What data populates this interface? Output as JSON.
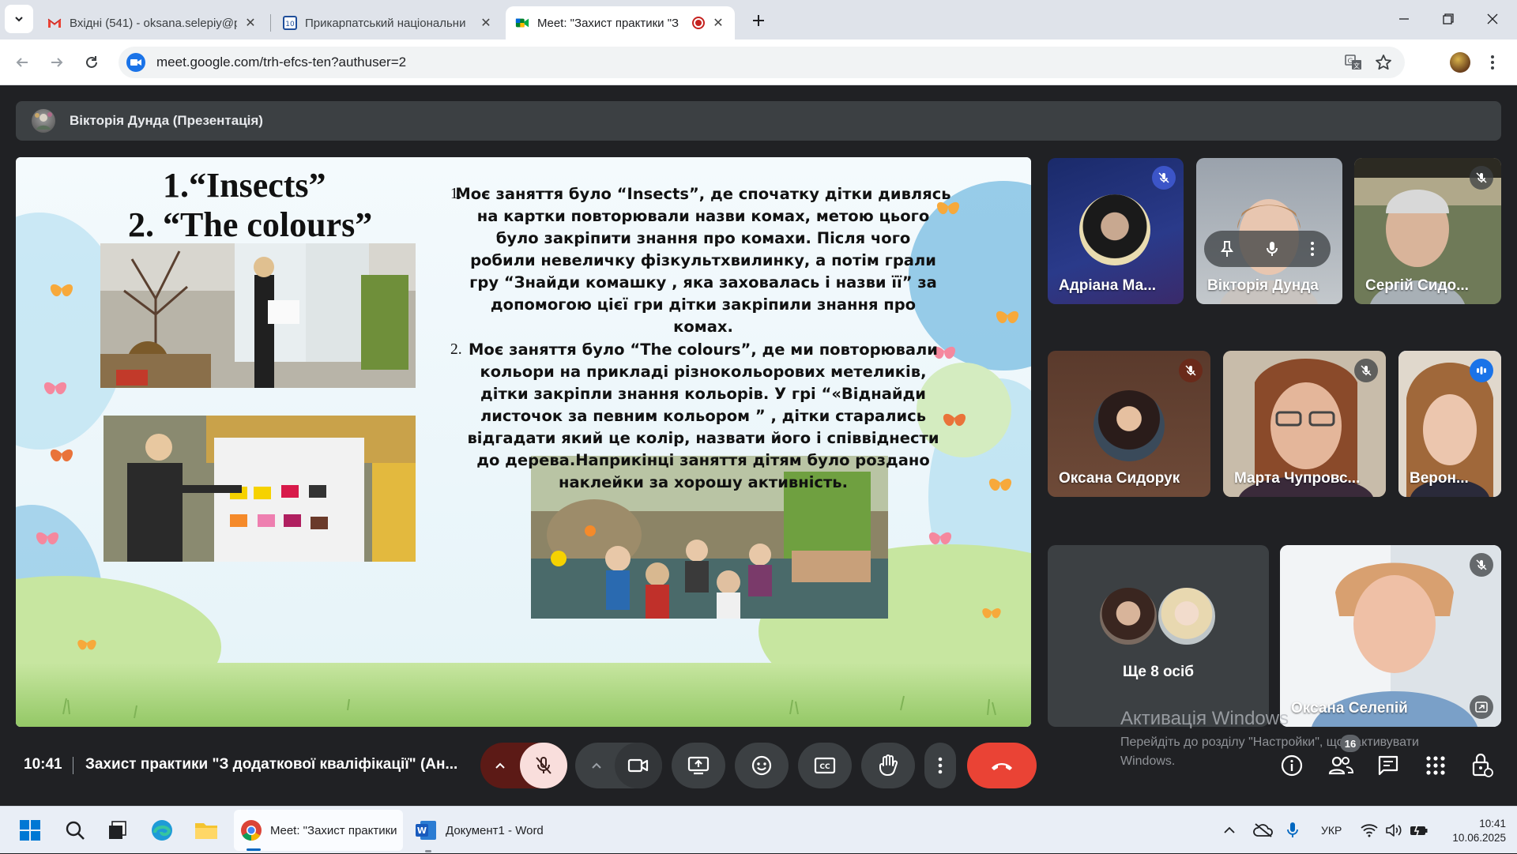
{
  "browser": {
    "tabs": [
      {
        "title": "Вхідні (541) - oksana.selepiy@p",
        "icon": "gmail-icon"
      },
      {
        "title": "Прикарпатський національни",
        "icon": "university-icon"
      },
      {
        "title": "Meet: \"Захист практики \"З",
        "icon": "meet-icon",
        "active": true
      }
    ],
    "url": "meet.google.com/trh-efcs-ten?authuser=2"
  },
  "meet": {
    "presenter_label": "Вікторія Дунда (Презентація)",
    "slide": {
      "title_line1": "1.“Insects”",
      "title_line2": "2. “The colours”",
      "item1_num": "1.",
      "item1_lines": [
        "Моє заняття було “Insects”, де спочатку дітки дивлясь",
        "на картки повторювали назви комах, метою цього",
        "було закріпити знання про комахи. Після чого",
        "робили невеличку фізкультхвилинку, а потім грали",
        "гру “Знайди комашку , яка заховалась і назви її” за",
        "допомогою цієї гри дітки закріпили знання про",
        "комах."
      ],
      "item2_num": "2.",
      "item2_lines": [
        "Моє заняття було “The colours”, де ми повторювали",
        "кольори на прикладі різнокольорових метеликів,",
        "дітки закріпли знання кольорів. У грі “«Віднайди",
        "листочок за певним кольором ” , дітки старались",
        "відгадати який це колір, назвати його і співвіднести",
        "до дерева.Наприкінці заняття дітям було роздано",
        "наклейки за хорошу активність."
      ]
    },
    "participants": [
      {
        "name": "Адріана Ма...",
        "muted": true
      },
      {
        "name": "Вікторія Дунда",
        "muted": false,
        "hover_controls": true
      },
      {
        "name": "Сергій Сидо...",
        "muted": true
      },
      {
        "name": "Оксана Сидорук",
        "muted": true
      },
      {
        "name": "Марта Чупровс...",
        "muted": true
      },
      {
        "name": "Верон...",
        "speaking": true
      },
      {
        "name": "Ще 8 осіб",
        "count": 8
      },
      {
        "name": "Оксана Селепій",
        "muted": true
      }
    ],
    "activation": {
      "title": "Активація Windows",
      "text": "Перейдіть до розділу \"Настройки\", щоб активувати Windows."
    },
    "time": "10:41",
    "meeting_title": "Захист практики \"З додаткової кваліфікації\" (Ан...",
    "people_badge": "16"
  },
  "taskbar": {
    "chrome_label": "Meet: \"Захист практики",
    "word_label": "Документ1 - Word",
    "lang": "УКР",
    "time": "10:41",
    "date": "10.06.2025"
  },
  "colors": {
    "meet_bg": "#202124",
    "control_bg": "#3c4043",
    "end_call": "#ea4335",
    "mic_off": "#f9dedc",
    "accent_blue": "#8ab4f8"
  }
}
